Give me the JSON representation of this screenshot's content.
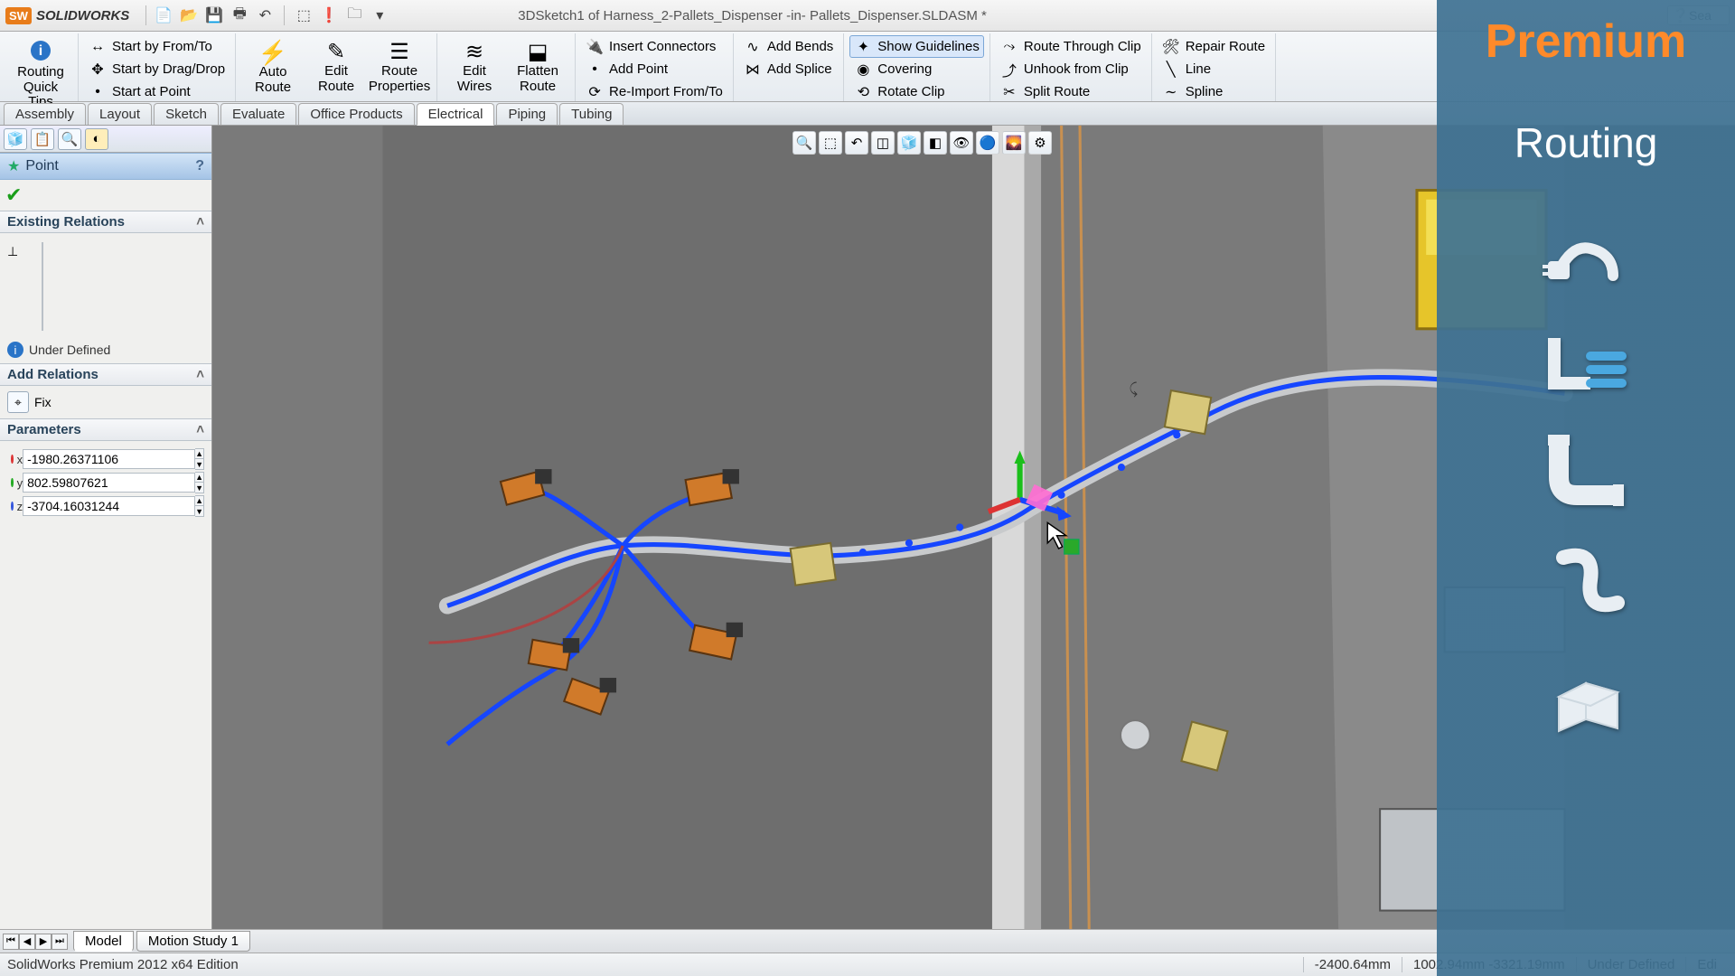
{
  "title": {
    "brand": "SOLIDWORKS",
    "document": "3DSketch1 of Harness_2-Pallets_Dispenser -in- Pallets_Dispenser.SLDASM *"
  },
  "search": {
    "placeholder": "Sea"
  },
  "ribbon": {
    "routing_quick_tips": "Routing\nQuick\nTips",
    "start_group": {
      "from_to": "Start by From/To",
      "drag_drop": "Start by Drag/Drop",
      "at_point": "Start at Point"
    },
    "auto_route": "Auto\nRoute",
    "edit_route": "Edit\nRoute",
    "route_properties": "Route\nProperties",
    "edit_wires": "Edit\nWires",
    "flatten_route": "Flatten\nRoute",
    "cmds_a": {
      "insert_connectors": "Insert Connectors",
      "add_point": "Add Point",
      "reimport": "Re-Import From/To"
    },
    "cmds_b": {
      "add_bends": "Add Bends",
      "add_splice": "Add Splice"
    },
    "cmds_c": {
      "show_guidelines": "Show Guidelines",
      "covering": "Covering",
      "rotate_clip": "Rotate Clip"
    },
    "cmds_d": {
      "route_through_clip": "Route Through Clip",
      "unhook": "Unhook from Clip",
      "split_route": "Split Route"
    },
    "cmds_e": {
      "repair_route": "Repair Route",
      "line": "Line",
      "spline": "Spline"
    }
  },
  "tabs": [
    "Assembly",
    "Layout",
    "Sketch",
    "Evaluate",
    "Office Products",
    "Electrical",
    "Piping",
    "Tubing"
  ],
  "tabs_active_index": 5,
  "pm": {
    "title": "Point",
    "help": "?",
    "sections": {
      "existing": {
        "title": "Existing Relations",
        "status": "Under Defined"
      },
      "add": {
        "title": "Add Relations",
        "fix": "Fix"
      },
      "params": {
        "title": "Parameters",
        "x": "-1980.26371106",
        "y": "802.59807621",
        "z": "-3704.16031244"
      }
    }
  },
  "bottom": {
    "tabs": [
      "Model",
      "Motion Study 1"
    ],
    "active": 0
  },
  "status": {
    "edition": "SolidWorks Premium 2012 x64 Edition",
    "coord1": "-2400.64mm",
    "coord2": "1002.94mm -3321.19mm",
    "defined": "Under Defined",
    "edit": "Edi"
  },
  "overlay": {
    "t1": "Premium",
    "t2": "Routing"
  }
}
